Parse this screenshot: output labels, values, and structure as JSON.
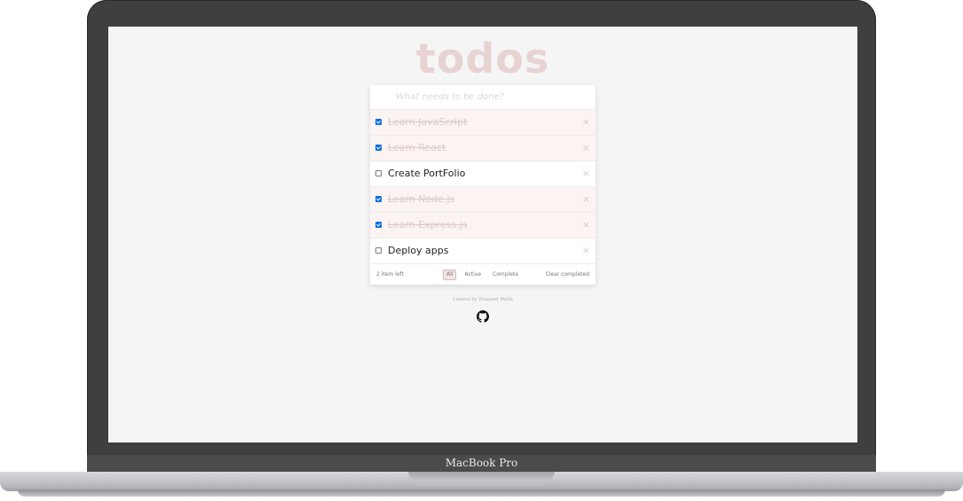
{
  "device": {
    "brand": "MacBook Pro"
  },
  "app": {
    "title": "todos"
  },
  "new_todo": {
    "placeholder": "What needs to be done?"
  },
  "todos": [
    {
      "label": "Learn JavaScript",
      "completed": true
    },
    {
      "label": "Learn React",
      "completed": true
    },
    {
      "label": "Create PortFolio",
      "completed": false
    },
    {
      "label": "Learn Node.js",
      "completed": true
    },
    {
      "label": "Learn Express.js",
      "completed": true
    },
    {
      "label": "Deploy apps",
      "completed": false
    }
  ],
  "delete_glyph": "×",
  "footer": {
    "count_text": "2 item left",
    "filters": [
      "All",
      "Active",
      "Complete"
    ],
    "active_filter": "All",
    "clear_label": "Clear completed"
  },
  "credit": "Created by Vivasjeet Mallik",
  "icons": {
    "github": "github-icon"
  },
  "colors": {
    "title": "#e8d3d3",
    "checked": "#0a6fe0",
    "completed_bg": "#fcf3f3"
  }
}
